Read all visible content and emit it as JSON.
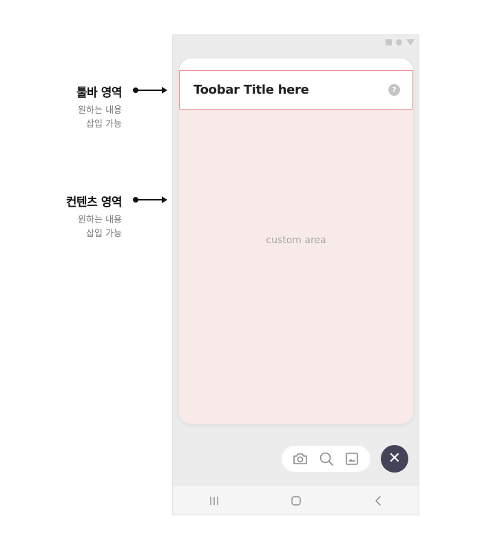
{
  "annotations": {
    "toolbar": {
      "title": "툴바 영역",
      "desc_line1": "원하는 내용",
      "desc_line2": "삽입 가능"
    },
    "content": {
      "title": "컨텐츠 영역",
      "desc_line1": "원하는 내용",
      "desc_line2": "삽입 가능"
    }
  },
  "dialog": {
    "toolbar_title": "Toobar Title here",
    "help_icon": "question-mark-icon",
    "content_label": "custom area"
  },
  "action_bar": {
    "icons": [
      "camera-icon",
      "search-icon",
      "image-icon"
    ],
    "close_icon": "close-icon"
  },
  "system_nav": {
    "icons": [
      "recent-apps-icon",
      "home-icon",
      "back-icon"
    ]
  },
  "colors": {
    "highlight_border": "#f08a8a",
    "content_bg": "#f9eaea",
    "close_button_bg": "#454358",
    "phone_bg": "#ececec"
  }
}
